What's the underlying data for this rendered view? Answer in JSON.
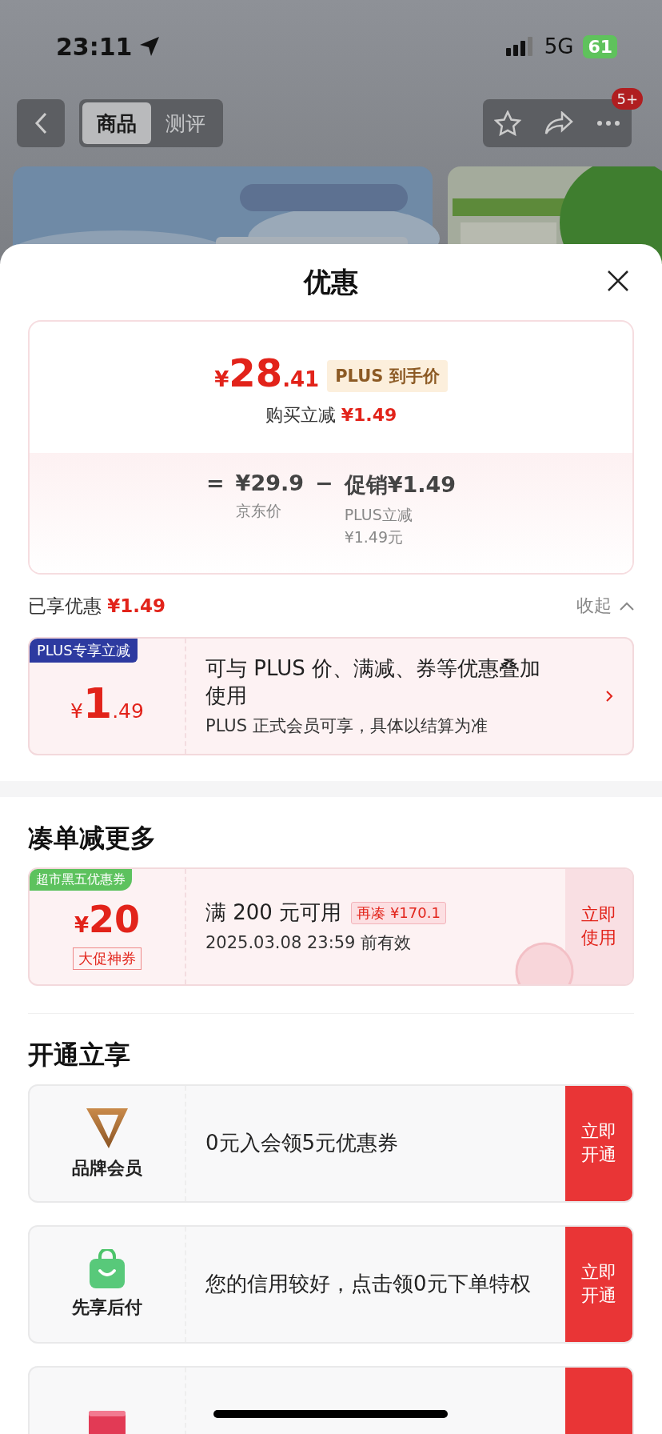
{
  "status_bar": {
    "time": "23:11",
    "network": "5G",
    "battery": "61"
  },
  "nav": {
    "tabs": [
      {
        "label": "商品",
        "selected": true
      },
      {
        "label": "测评",
        "selected": false
      }
    ],
    "badge": "5+"
  },
  "sheet": {
    "title": "优惠",
    "price_card": {
      "symbol": "¥",
      "integer": "28",
      "decimal": ".41",
      "badge": "PLUS 到手价",
      "saving_label": "购买立减",
      "saving_amount": "¥1.49",
      "equals": "=",
      "base_price": "¥29.9",
      "minus": "−",
      "promo": "促销¥1.49",
      "base_label": "京东价",
      "promo_label": "PLUS立减",
      "promo_amount": "¥1.49元"
    },
    "applied": {
      "label": "已享优惠",
      "amount": "¥1.49",
      "toggle": "收起"
    },
    "plus_offer": {
      "tag": "PLUS专享立减",
      "symbol": "¥",
      "integer": "1",
      "decimal": ".49",
      "title": "可与 PLUS 价、满减、券等优惠叠加使用",
      "note": "PLUS 正式会员可享，具体以结算为准"
    },
    "more": {
      "title": "凑单减更多",
      "coupon": {
        "tag": "超市黑五优惠券",
        "symbol": "¥",
        "amount": "20",
        "subtag": "大促神券",
        "condition": "满 200 元可用",
        "extra": "再凑 ¥170.1",
        "validity": "2025.03.08 23:59 前有效",
        "button": "立即使用"
      }
    },
    "open": {
      "title": "开通立享",
      "items": [
        {
          "kind": "brand",
          "name": "品牌会员",
          "text": "0元入会领5元优惠券",
          "button": "立即开通"
        },
        {
          "kind": "paylater",
          "name": "先享后付",
          "text": "您的信用较好，点击领0元下单特权",
          "button": "立即开通"
        },
        {
          "kind": "card"
        }
      ]
    }
  }
}
